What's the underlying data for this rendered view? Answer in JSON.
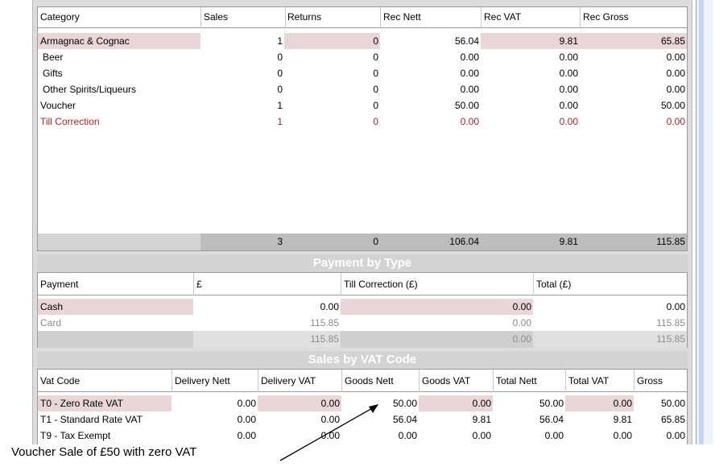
{
  "category_table": {
    "headers": [
      "Category",
      "Sales",
      "Returns",
      "Rec Nett",
      "Rec VAT",
      "Rec Gross"
    ],
    "rows": [
      {
        "category": "Armagnac & Cognac",
        "sales": "1",
        "returns": "0",
        "rec_nett": "56.04",
        "rec_vat": "9.81",
        "rec_gross": "65.85",
        "selected": true
      },
      {
        "category": "Beer",
        "sales": "0",
        "returns": "0",
        "rec_nett": "0.00",
        "rec_vat": "0.00",
        "rec_gross": "0.00"
      },
      {
        "category": "Gifts",
        "sales": "0",
        "returns": "0",
        "rec_nett": "0.00",
        "rec_vat": "0.00",
        "rec_gross": "0.00"
      },
      {
        "category": "Other Spirits/Liqueurs",
        "sales": "0",
        "returns": "0",
        "rec_nett": "0.00",
        "rec_vat": "0.00",
        "rec_gross": "0.00"
      },
      {
        "category": "Voucher",
        "sales": "1",
        "returns": "0",
        "rec_nett": "50.00",
        "rec_vat": "0.00",
        "rec_gross": "50.00"
      },
      {
        "category": "Till Correction",
        "sales": "1",
        "returns": "0",
        "rec_nett": "0.00",
        "rec_vat": "0.00",
        "rec_gross": "0.00",
        "red": true
      }
    ],
    "totals": {
      "sales": "3",
      "returns": "0",
      "rec_nett": "106.04",
      "rec_vat": "9.81",
      "rec_gross": "115.85"
    }
  },
  "payment_section": {
    "title": "Payment by Type",
    "headers": [
      "Payment",
      "£",
      "Till Correction (£)",
      "Total (£)"
    ],
    "rows": [
      {
        "payment": "Cash",
        "amount": "0.00",
        "till_correction": "0.00",
        "total": "0.00",
        "selected": true
      },
      {
        "payment": "Card",
        "amount": "115.85",
        "till_correction": "0.00",
        "total": "115.85",
        "grey": true
      }
    ],
    "totals": {
      "amount": "115.85",
      "till_correction": "0.00",
      "total": "115.85"
    }
  },
  "vat_section": {
    "title": "Sales by VAT Code",
    "headers": [
      "Vat Code",
      "Delivery Nett",
      "Delivery VAT",
      "Goods Nett",
      "Goods VAT",
      "Total Nett",
      "Total VAT",
      "Gross"
    ],
    "rows": [
      {
        "code": "T0 - Zero Rate VAT",
        "delivery_nett": "0.00",
        "delivery_vat": "0.00",
        "goods_nett": "50.00",
        "goods_vat": "0.00",
        "total_nett": "50.00",
        "total_vat": "0.00",
        "gross": "50.00",
        "selected": true
      },
      {
        "code": "T1 - Standard Rate VAT",
        "delivery_nett": "0.00",
        "delivery_vat": "0.00",
        "goods_nett": "56.04",
        "goods_vat": "9.81",
        "total_nett": "56.04",
        "total_vat": "9.81",
        "gross": "65.85"
      },
      {
        "code": "T9 - Tax Exempt",
        "delivery_nett": "0.00",
        "delivery_vat": "0.00",
        "goods_nett": "0.00",
        "goods_vat": "0.00",
        "total_nett": "0.00",
        "total_vat": "0.00",
        "gross": "0.00"
      }
    ]
  },
  "annotation": {
    "text": "Voucher Sale of £50 with zero VAT"
  },
  "colors": {
    "selected_row": "#e8d6d8",
    "till_correction_red": "#b22222",
    "section_title": "#ffffff",
    "panel_bg": "#dcdcdc"
  }
}
